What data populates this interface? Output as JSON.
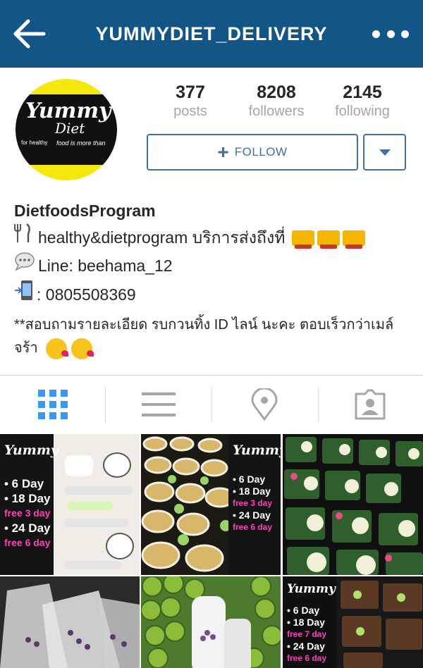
{
  "header": {
    "title": "YUMMYDIET_DELIVERY"
  },
  "avatar": {
    "logo_main": "Yummy",
    "logo_sub": "Diet",
    "logo_small_left": "for healthy",
    "logo_small_right": "food is more than"
  },
  "stats": {
    "posts": {
      "value": "377",
      "label": "posts"
    },
    "followers": {
      "value": "8208",
      "label": "followers"
    },
    "following": {
      "value": "2145",
      "label": "following"
    }
  },
  "actions": {
    "follow_label": "FOLLOW"
  },
  "bio": {
    "name": "DietfoodsProgram",
    "line1": "healthy&dietprogram บริการส่งถึงที่",
    "line2": "Line: beehama_12",
    "line3": ": 0805508369",
    "desc": "**สอบถามรายละเอียด รบกวนทิ้ง ID ไลน์ นะคะ ตอบเร็วกว่าเมล์จร้า"
  },
  "tabs": [
    "grid-view",
    "list-view",
    "places",
    "tagged"
  ],
  "colors": {
    "header_bg": "#125688",
    "accent": "#3f729b",
    "active_tab": "#3897f0",
    "inactive_tab": "#a6a6a6"
  },
  "grid": {
    "post1": {
      "brand": "Yummy",
      "lines": [
        "• 6 Day",
        "• 18 Day",
        "free 3 day",
        "• 24 Day",
        "free 6 day"
      ]
    },
    "post9": {
      "brand": "Yummy",
      "lines": [
        "• 6 Day",
        "• 18 Day",
        "free 7 day",
        "• 24 Day",
        "free 6 day"
      ]
    }
  }
}
